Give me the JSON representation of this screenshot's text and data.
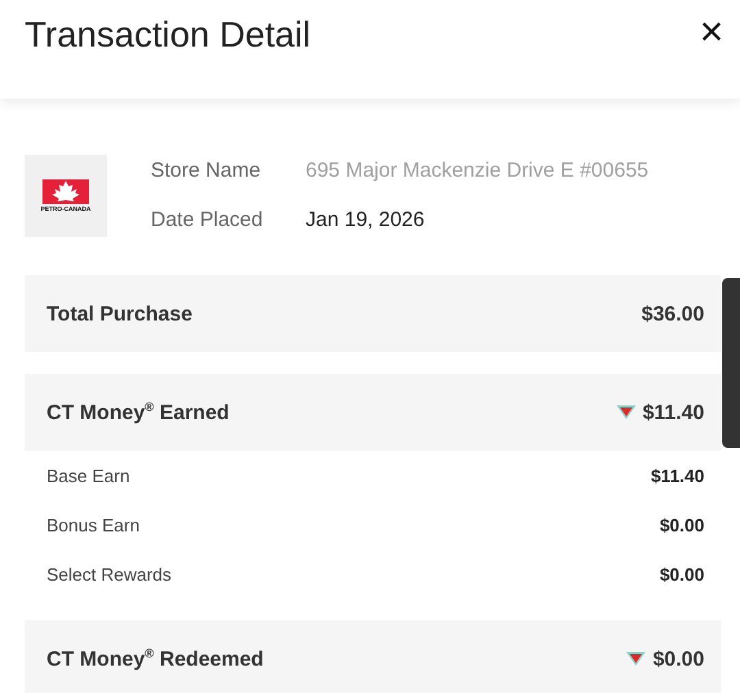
{
  "window": {
    "title": "Transaction Detail",
    "close": "×"
  },
  "store": {
    "logo_text": "PETRO-CANADA",
    "fields": [
      {
        "label": "Store Name",
        "value": "695 Major Mackenzie Drive E #00655",
        "faded": true
      },
      {
        "label": "Date Placed",
        "value": "Jan 19, 2026",
        "faded": false
      }
    ]
  },
  "rows": [
    {
      "kind": "total",
      "label": "Total Purchase",
      "value": "$36.00"
    },
    {
      "kind": "points",
      "label": "CT Money$^{®}$ Earned",
      "value": "$11.40"
    },
    {
      "kind": "sub",
      "label": "Base Earn",
      "value": "$11.40"
    },
    {
      "kind": "sub",
      "label": "Bonus Earn",
      "value": "$0.00"
    },
    {
      "kind": "sub",
      "label": "Select Rewards",
      "value": "$0.00"
    },
    {
      "kind": "points",
      "label": "CT Money$^{®}$ Redeemed",
      "value": "$0.00"
    }
  ]
}
